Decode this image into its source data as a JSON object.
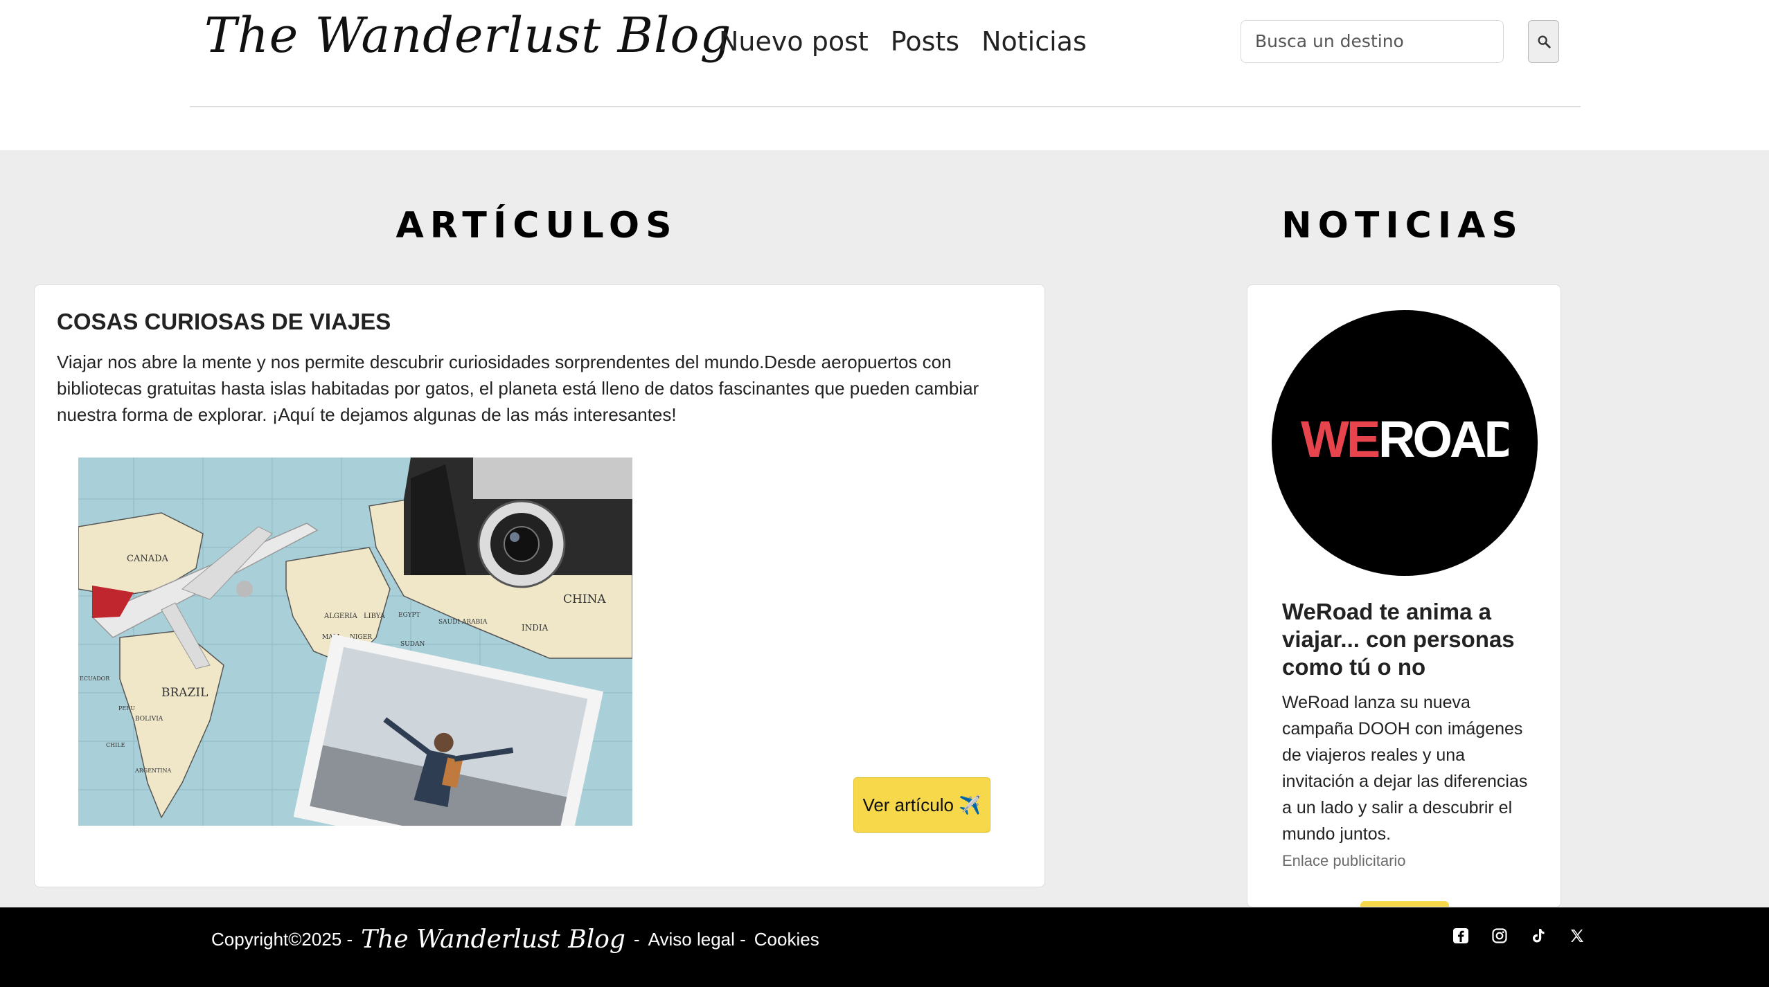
{
  "header": {
    "brand": "The Wanderlust Blog",
    "nav": [
      "Nuevo post",
      "Posts",
      "Noticias"
    ],
    "search_placeholder": "Busca un destino"
  },
  "main": {
    "articles_title": "ARTÍCULOS",
    "news_title": "NOTICIAS"
  },
  "article": {
    "title": "COSAS CURIOSAS DE VIAJES",
    "text": "Viajar nos abre la mente y nos permite descubrir curiosidades sorprendentes del mundo.Desde aeropuertos con bibliotecas gratuitas hasta islas habitadas por gatos, el planeta está lleno de datos fascinantes que pueden cambiar nuestra forma de explorar. ¡Aquí te dejamos algunas de las más interesantes!",
    "button_label": "Ver artículo ✈️",
    "map_labels": [
      "CANADA",
      "BRAZIL",
      "CHINA",
      "INDIA",
      "ALGERIA",
      "LIBYA",
      "SUDAN",
      "SAUDI ARABIA",
      "MALI",
      "NIGER",
      "PERU",
      "BOLIVIA",
      "CHILE",
      "ARGENTINA",
      "ECUADOR",
      "EGYPT"
    ]
  },
  "news": {
    "logo_text": "WEROAD",
    "title": "WeRoad te anima a viajar... con personas como tú o no",
    "text": "WeRoad lanza su nueva campaña DOOH con imágenes de viajeros reales y una invitación a dejar las diferencias a un lado y salir a descubrir el mundo juntos.",
    "link": "Enlace publicitario"
  },
  "footer": {
    "copyright": "Copyright©2025 -",
    "brand": "The Wanderlust Blog",
    "sep": "-",
    "legal": "Aviso legal -",
    "cookies": "Cookies"
  },
  "colors": {
    "accent_yellow": "#f7d84a",
    "page_bg": "#ededee",
    "logo_red": "#e8444d"
  }
}
